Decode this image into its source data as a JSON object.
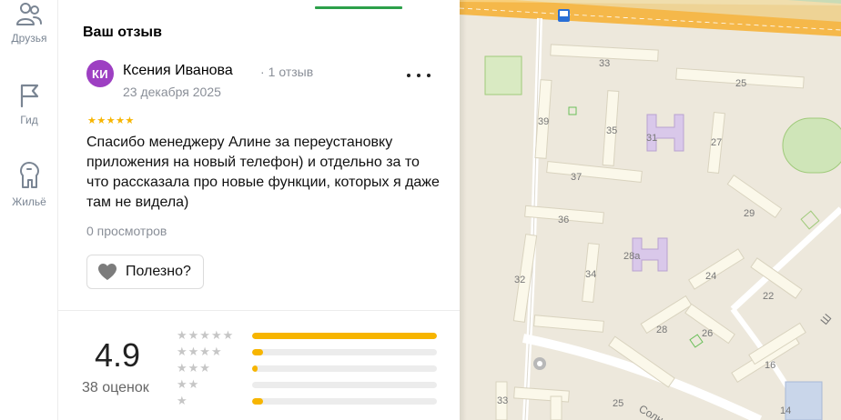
{
  "rail": {
    "items": [
      {
        "label": "Друзья",
        "icon": "friends-icon"
      },
      {
        "label": "Гид",
        "icon": "flag-icon"
      },
      {
        "label": "Жильё",
        "icon": "housing-icon"
      }
    ]
  },
  "review": {
    "section_title": "Ваш отзыв",
    "avatar_initials": "КИ",
    "author_name": "Ксения Иванова",
    "author_reviews": "1 отзыв",
    "author_dot": "·",
    "date": "23 декабря 2025",
    "stars": "★★★★★",
    "text": "Спасибо менеджеру Алине за переустановку приложения на новый телефон) и отдельно за то что рассказала про новые функции, которых я даже там не видела)",
    "views": "0 просмотров",
    "useful_label": "Полезно?",
    "rating": 5
  },
  "rating_summary": {
    "value": "4.9",
    "count_label": "38 оценок",
    "distribution": [
      {
        "stars": "★★★★★",
        "fraction": 1.0
      },
      {
        "stars": "★★★★",
        "fraction": 0.06
      },
      {
        "stars": "★★★",
        "fraction": 0.03
      },
      {
        "stars": "★★",
        "fraction": 0.0
      },
      {
        "stars": "★",
        "fraction": 0.06
      }
    ]
  },
  "map": {
    "labels": [
      "33",
      "25",
      "39",
      "35",
      "31",
      "27",
      "37",
      "29",
      "36",
      "28а",
      "32",
      "34",
      "24",
      "22",
      "28",
      "26",
      "16",
      "33",
      "25",
      "14",
      "Солн",
      "Ш"
    ]
  },
  "colors": {
    "accent_green": "#2ca04a",
    "star_yellow": "#f7b500",
    "avatar_purple": "#9d3fc2",
    "road_orange": "#f5b84a",
    "map_bg": "#ede8dc"
  }
}
